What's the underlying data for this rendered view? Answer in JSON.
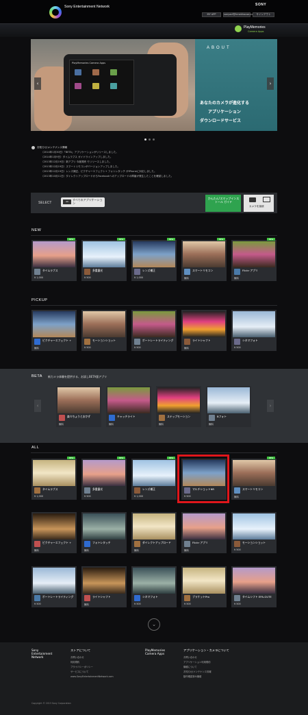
{
  "header": {
    "brand": "Sony Entertainment Network",
    "sony": "SONY",
    "buttons": [
      "MY APP",
      "sonyacf@hmekhouse.com",
      "サインアウト"
    ],
    "playmemories": "PlayMemories",
    "camera_apps": "Camera Apps"
  },
  "hero": {
    "about": "ABOUT",
    "camera_screen_title": "PlayMemories Camera Apps",
    "copy": [
      "あなたのカメラが進化する",
      "アプリケーション",
      "ダウンロードサービス"
    ],
    "prev": "‹",
    "next": "›"
  },
  "news": [
    "お知らせ/メンテナンス情報",
    "（2014年1月30日）「BETA」アプリケーションがリリースしました。",
    "（2014年1月9日）タイムラプス ガイドラインアップしました。",
    "（2013年12月19日）新アプリ 今度発売 モリリースしました。",
    "（2013年12月19日）スマートリモコンがバージョンアップしました。",
    "（2013年12月19日）レンズ補正、ピクチャーエフェクト+ フォトレタッチ がiPhoneに対応しました。",
    "（2013年10月11日）ダイレクトアップロードからFacebookへのアップロードの障害が発生したことを確認しました。"
  ],
  "select": {
    "label": "SELECT",
    "tag": "All",
    "dropdown": "すべてのアプリケーション",
    "green_button": "かんたん!スマップインストール ガイド",
    "camera_button": "カメラを接続"
  },
  "sections": {
    "new": "NEW",
    "pickup": "PICKUP",
    "beta": "BETA",
    "beta_desc": "新カメラ体験を提供する、お試しBETA版アプリ",
    "all": "ALL"
  },
  "new_cards": [
    {
      "name": "タイムラプス",
      "price": "¥ 1,000",
      "badge": "NEW"
    },
    {
      "name": "多重露光",
      "price": "¥ 500",
      "badge": "NEW"
    },
    {
      "name": "レンズ補正",
      "price": "¥ 1,000",
      "badge": "NEW"
    },
    {
      "name": "スマートリモコン",
      "price": "無料",
      "badge": "NEW"
    },
    {
      "name": "Flickr アプリ",
      "price": "無料",
      "badge": "NEW"
    }
  ],
  "pickup_cards": [
    {
      "name": "ピクチャーエフェクト +",
      "price": "無料"
    },
    {
      "name": "モーションショット",
      "price": "¥ 500"
    },
    {
      "name": "ポートレートライティング",
      "price": "¥ 500"
    },
    {
      "name": "ライトシャフト",
      "price": "無料"
    },
    {
      "name": "シネマフォト",
      "price": "¥ 500"
    }
  ],
  "beta_cards": [
    {
      "name": "楽々ちょうとおかず",
      "price": "無料"
    },
    {
      "name": "キャッチライト",
      "price": "無料"
    },
    {
      "name": "ステップモーション",
      "price": "無料"
    },
    {
      "name": "Bフォト",
      "price": "無料"
    }
  ],
  "all_row1": [
    {
      "name": "タイムラプス",
      "price": "¥ 1,000",
      "badge": "NEW"
    },
    {
      "name": "多重露光",
      "price": "¥ 500",
      "badge": "NEW"
    },
    {
      "name": "レンズ補正",
      "price": "¥ 1,000",
      "badge": "NEW"
    },
    {
      "name": "マルチショットNR",
      "price": "¥ 500",
      "badge": ""
    },
    {
      "name": "スマートリモコン",
      "price": "無料",
      "badge": "NEW"
    }
  ],
  "all_row2": [
    {
      "name": "ピクチャーエフェクト +",
      "price": "無料"
    },
    {
      "name": "フォトレタッチ",
      "price": "無料"
    },
    {
      "name": "ダイレクトアップロード",
      "price": "無料"
    },
    {
      "name": "Flickr アプリ",
      "price": "無料"
    },
    {
      "name": "モーションショット",
      "price": "¥ 500"
    }
  ],
  "all_row3": [
    {
      "name": "ポートレートライティング",
      "price": "¥ 500"
    },
    {
      "name": "ライトシャフト",
      "price": "無料"
    },
    {
      "name": "シネマフォト",
      "price": "¥ 500"
    },
    {
      "name": "ブラケットPro",
      "price": "¥ 500"
    },
    {
      "name": "タイムシフト EPA-GUTE",
      "price": "¥ 500"
    }
  ],
  "more": "⌄",
  "footer": {
    "col1": [
      "Sony",
      "Entertainment",
      "Network"
    ],
    "col2_head": "ストアについて",
    "col2_links": [
      "お問い合わせ",
      "利用規約",
      "プライバシーポリシー",
      "サービスについて",
      "www.SonyEntertainmentNetwork.com"
    ],
    "col3_head": [
      "PlayMemories",
      "Camera Apps"
    ],
    "col4_head": "アプリケーション・カメラについて",
    "col4_links": [
      "お問い合わせ",
      "アプリケーション利用規約",
      "機種について",
      "お知らせ/メンテナンス情報",
      "動作確認済み機種"
    ],
    "copyright": "Copyright © 2013 Sony Corporation"
  },
  "colors": {
    "highlight": "#e0161b",
    "new_badge": "#3fc23f",
    "green_button": "#2fa34f"
  },
  "icons": [
    "chevron-left-icon",
    "chevron-right-icon",
    "info-icon",
    "camera-icon",
    "chevron-down-icon"
  ]
}
